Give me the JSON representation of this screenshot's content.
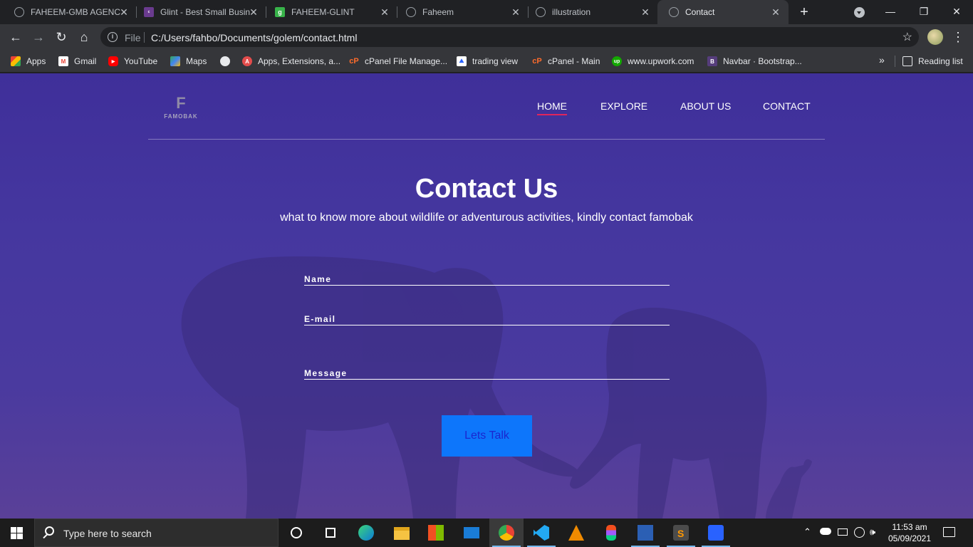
{
  "browser": {
    "tabs": [
      {
        "title": "FAHEEM-GMB AGENCY",
        "icon": "globe-icon",
        "active": false
      },
      {
        "title": "Glint - Best Small Business",
        "icon": "colorlib-icon",
        "active": false
      },
      {
        "title": "FAHEEM-GLINT",
        "icon": "g-icon",
        "active": false
      },
      {
        "title": "Faheem",
        "icon": "globe-icon",
        "active": false
      },
      {
        "title": "illustration",
        "icon": "globe-icon",
        "active": false
      },
      {
        "title": "Contact",
        "icon": "globe-icon",
        "active": true
      }
    ],
    "new_tab_symbol": "+",
    "window_controls": {
      "minimize": "—",
      "maximize": "❐",
      "close": "✕"
    },
    "address": {
      "scheme_label": "File",
      "url": "C:/Users/fahbo/Documents/golem/contact.html"
    },
    "bookmarks": [
      {
        "label": "Apps",
        "icon": "apps-grid-icon",
        "color": "#ea4335"
      },
      {
        "label": "Gmail",
        "icon": "gmail-icon",
        "color": "#ea4335"
      },
      {
        "label": "YouTube",
        "icon": "youtube-icon",
        "color": "#ff0000"
      },
      {
        "label": "Maps",
        "icon": "maps-icon",
        "color": "#34a853"
      },
      {
        "label": "",
        "icon": "globe-icon",
        "color": "#e8eaed"
      },
      {
        "label": "Apps, Extensions, a...",
        "icon": "extensions-icon",
        "color": "#e34c4c"
      },
      {
        "label": "cPanel File Manage...",
        "icon": "cpanel-icon",
        "color": "#ff6c2c"
      },
      {
        "label": "trading view",
        "icon": "tradingview-icon",
        "color": "#2962ff"
      },
      {
        "label": "cPanel - Main",
        "icon": "cpanel-icon",
        "color": "#ff6c2c"
      },
      {
        "label": "www.upwork.com",
        "icon": "upwork-icon",
        "color": "#14a800"
      },
      {
        "label": "Navbar · Bootstrap...",
        "icon": "bootstrap-icon",
        "color": "#563d7c"
      }
    ],
    "overflow_label": "»",
    "reading_list_label": "Reading list"
  },
  "site": {
    "logo_mark": "F",
    "logo_name": "FAMOBAK",
    "nav": [
      {
        "label": "HOME",
        "active": true
      },
      {
        "label": "EXPLORE",
        "active": false
      },
      {
        "label": "ABOUT US",
        "active": false
      },
      {
        "label": "CONTACT",
        "active": false
      }
    ],
    "title": "Contact Us",
    "subtitle": "what to know more about wildlife or adventurous activities, kindly contact famobak",
    "form": {
      "name_label": "Name",
      "email_label": "E-mail",
      "message_label": "Message",
      "submit_label": "Lets Talk"
    },
    "colors": {
      "accent_underline": "#e0255c",
      "button": "#0d76fb",
      "button_text": "#1b27cf"
    }
  },
  "taskbar": {
    "search_placeholder": "Type here to search",
    "apps": [
      "cortana-icon",
      "task-view-icon",
      "edge-icon",
      "file-explorer-icon",
      "store-icon",
      "mail-icon",
      "chrome-icon",
      "vscode-icon",
      "vlc-icon",
      "figma-icon",
      "word-icon",
      "sublime-icon",
      "tradingview-icon"
    ],
    "time": "11:53 am",
    "date": "05/09/2021"
  }
}
